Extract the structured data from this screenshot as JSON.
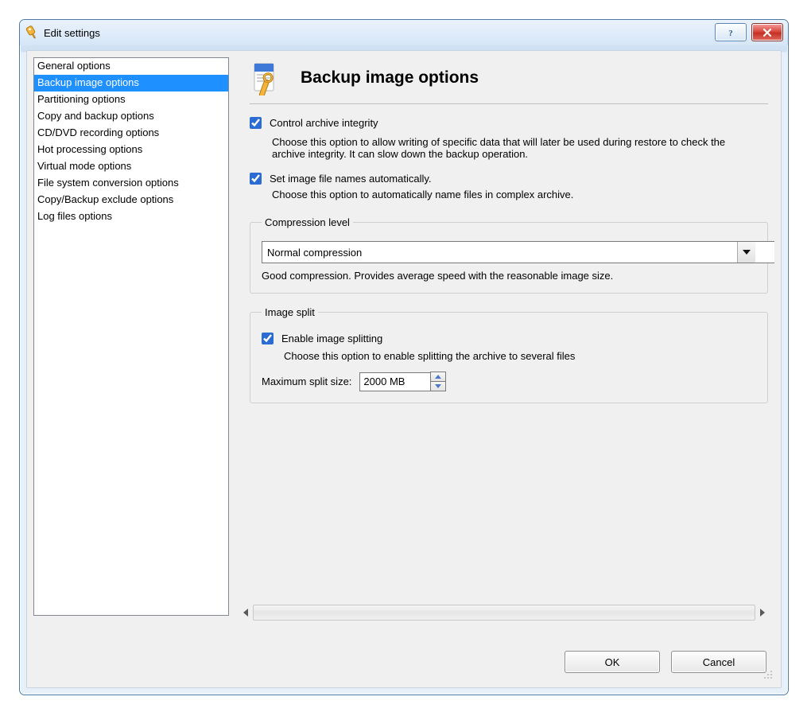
{
  "window": {
    "title": "Edit settings"
  },
  "sidebar": {
    "items": [
      "General options",
      "Backup image options",
      "Partitioning options",
      "Copy and backup options",
      "CD/DVD recording options",
      "Hot processing options",
      "Virtual mode options",
      "File system conversion options",
      "Copy/Backup exclude options",
      "Log files options"
    ],
    "selected_index": 1
  },
  "page": {
    "title": "Backup image options",
    "opt1": {
      "label": "Control archive integrity",
      "checked": true,
      "desc": "Choose this option to allow writing of specific data that will later be used during restore to check the archive integrity. It can slow down the backup operation."
    },
    "opt2": {
      "label": "Set image file names automatically.",
      "checked": true,
      "desc": "Choose this option to automatically name files in complex archive."
    },
    "compression": {
      "legend": "Compression level",
      "value": "Normal compression",
      "hint": "Good compression. Provides average speed with the reasonable image size."
    },
    "split": {
      "legend": "Image split",
      "enable_label": "Enable image splitting",
      "enable_checked": true,
      "enable_desc": "Choose this option to enable splitting the archive to several files",
      "size_label": "Maximum split size:",
      "size_value": "2000 MB"
    }
  },
  "buttons": {
    "ok": "OK",
    "cancel": "Cancel"
  }
}
